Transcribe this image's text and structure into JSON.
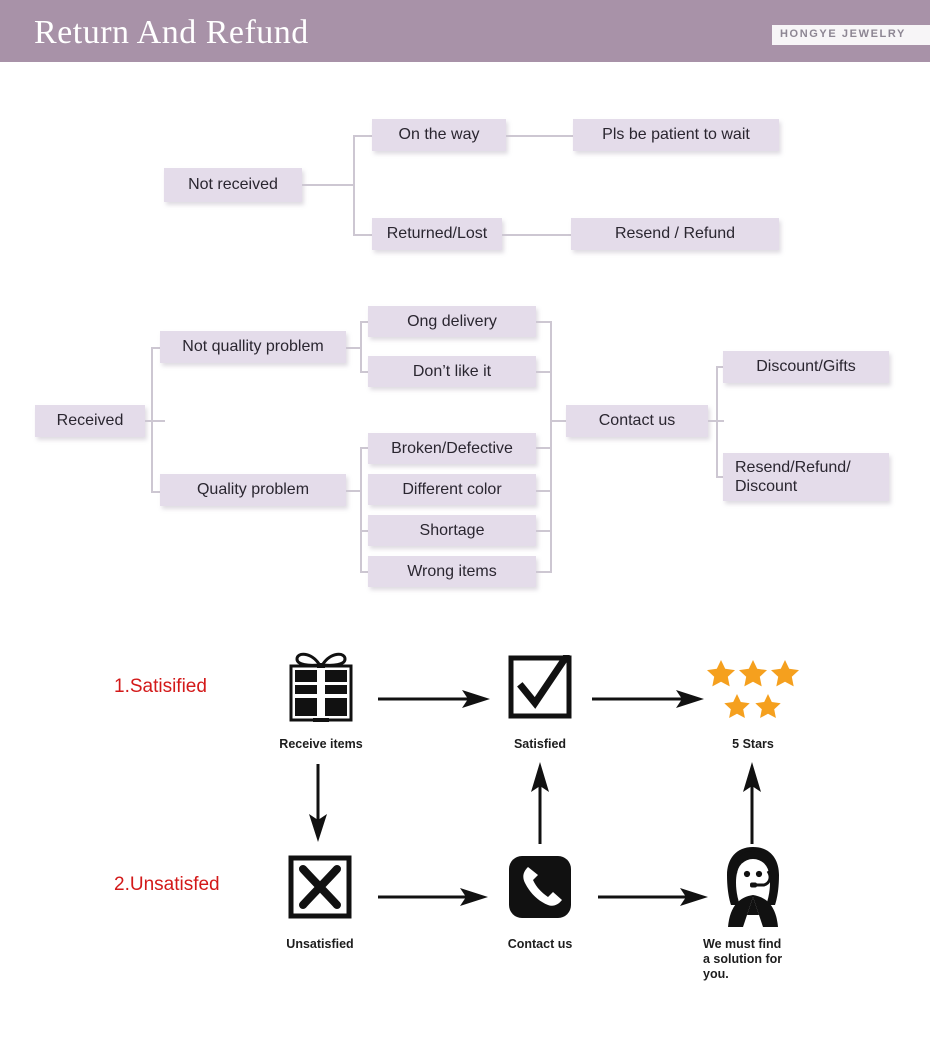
{
  "header": {
    "title": "Return And Refund",
    "brand": "HONGYE JEWELRY",
    "band_color": "#a892a8"
  },
  "theme": {
    "node_fill": "#e4dcea",
    "connector": "#cdc7d2",
    "red_text": "#d31919",
    "star_color": "#f5a01e"
  },
  "flow_not_received": {
    "root": "Not received",
    "branches": [
      {
        "condition": "On the way",
        "action": "Pls be patient to wait"
      },
      {
        "condition": "Returned/Lost",
        "action": "Resend / Refund"
      }
    ]
  },
  "flow_received": {
    "root": "Received",
    "groups": [
      {
        "label": "Not quallity problem",
        "reasons": [
          "Ong delivery",
          "Don’t like it"
        ]
      },
      {
        "label": "Quality problem",
        "reasons": [
          "Broken/Defective",
          "Different color",
          "Shortage",
          "Wrong items"
        ]
      }
    ],
    "contact": "Contact us",
    "outcomes": [
      "Discount/Gifts",
      "Resend/Refund/\nDiscount"
    ]
  },
  "process": {
    "rows": [
      {
        "label": "1.Satisified"
      },
      {
        "label": "2.Unsatisfed"
      }
    ],
    "steps": {
      "receive_items": "Receive items",
      "satisfied": "Satisfied",
      "five_stars": "5 Stars",
      "unsatisfied": "Unsatisfied",
      "contact_us": "Contact us",
      "solution": "We must find\na solution for\nyou."
    },
    "icons": {
      "receive_items": "gift-icon",
      "satisfied": "check-box-icon",
      "five_stars": "stars-icon",
      "unsatisfied": "x-box-icon",
      "contact_us": "phone-icon",
      "solution": "support-agent-icon"
    }
  }
}
